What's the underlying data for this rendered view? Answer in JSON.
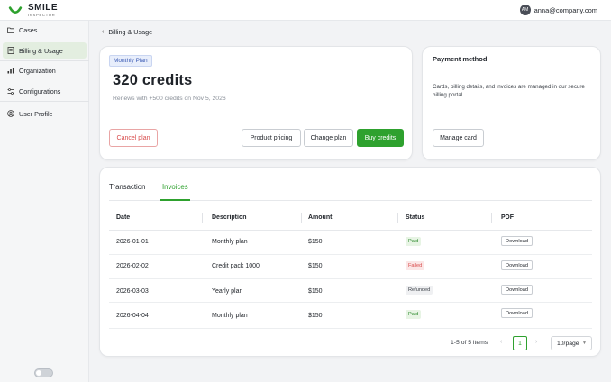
{
  "header": {
    "logo_text": "SMILE",
    "logo_sub": "INSPECTOR",
    "avatar_initials": "AM",
    "user_email": "anna@company.com"
  },
  "sidebar": {
    "items": [
      {
        "label": "Cases",
        "icon": "folder-icon",
        "active": false
      },
      {
        "label": "Billing & Usage",
        "icon": "receipt-icon",
        "active": true
      },
      {
        "label": "Organization",
        "icon": "org-chart-icon",
        "active": false
      },
      {
        "label": "Configurations",
        "icon": "sliders-icon",
        "active": false
      },
      {
        "label": "User Profile",
        "icon": "user-circle-icon",
        "active": false
      }
    ]
  },
  "breadcrumb": {
    "label": "Billing & Usage"
  },
  "plan": {
    "badge": "Monthly Plan",
    "credits": "320 credits",
    "renews": "Renews with +500 credits on Nov 5, 2026",
    "cancel_label": "Cancel plan",
    "pricing_label": "Product pricing",
    "change_label": "Change plan",
    "buy_label": "Buy credits"
  },
  "payment": {
    "title": "Payment method",
    "description": "Cards, billing details, and invoices are managed in our secure billing portal.",
    "manage_label": "Manage card"
  },
  "tabs": {
    "transaction": "Transaction",
    "invoices": "Invoices",
    "active": "invoices"
  },
  "table": {
    "columns": [
      "Date",
      "Description",
      "Amount",
      "Status",
      "PDF"
    ],
    "rows": [
      {
        "date": "2026-01-01",
        "description": "Monthly plan",
        "amount": "$150",
        "status": "Paid",
        "pdf": "Download"
      },
      {
        "date": "2026-02-02",
        "description": "Credit pack 1000",
        "amount": "$150",
        "status": "Failed",
        "pdf": "Download"
      },
      {
        "date": "2026-03-03",
        "description": "Yearly plan",
        "amount": "$150",
        "status": "Refunded",
        "pdf": "Download"
      },
      {
        "date": "2026-04-04",
        "description": "Monthly plan",
        "amount": "$150",
        "status": "Paid",
        "pdf": "Download"
      }
    ]
  },
  "pagination": {
    "total": "1-5 of 5 items",
    "page": "1",
    "page_size": "10/page"
  },
  "colors": {
    "accent": "#2ea12e",
    "danger": "#d84b4b",
    "badge_blue": "#3b5bb5"
  }
}
